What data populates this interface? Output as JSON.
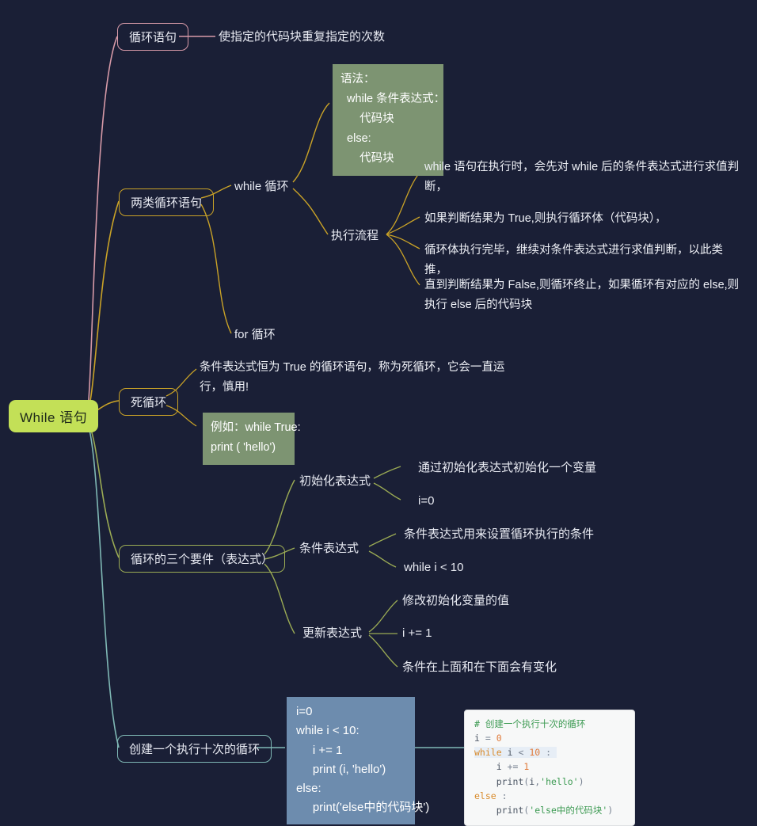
{
  "root": {
    "label": "While 语句"
  },
  "branches": {
    "loop_statement": {
      "label": "循环语句",
      "leaf": "使指定的代码块重复指定的次数"
    },
    "two_kinds": {
      "label": "两类循环语句",
      "while_loop": {
        "label": "while 循环",
        "syntax_block": "语法：\n  while 条件表达式：\n      代码块\n  else:\n      代码块",
        "flow": {
          "label": "执行流程",
          "items": [
            "while 语句在执行时，会先对 while 后的条件表达式进行求值判断，",
            "如果判断结果为 True,则执行循环体（代码块），",
            "循环体执行完毕，继续对条件表达式进行求值判断，以此类推，",
            "直到判断结果为 False,则循环终止，如果循环有对应的 else,则执行 else 后的代码块"
          ]
        }
      },
      "for_loop": {
        "label": "for 循环"
      }
    },
    "infinite_loop": {
      "label": "死循环",
      "description": "条件表达式恒为 True 的循环语句，称为死循环，它会一直运行，慎用!",
      "example_block": "例如：while True:\nprint ( 'hello')"
    },
    "three_elements": {
      "label": "循环的三个要件（表达式）",
      "items": [
        {
          "label": "初始化表达式",
          "leaves": [
            "通过初始化表达式初始化一个变量",
            "i=0"
          ]
        },
        {
          "label": "条件表达式",
          "leaves": [
            "条件表达式用来设置循环执行的条件",
            "while i < 10"
          ]
        },
        {
          "label": "更新表达式",
          "leaves": [
            "修改初始化变量的值",
            "i += 1",
            "条件在上面和在下面会有变化"
          ]
        }
      ]
    },
    "create_loop": {
      "label": "创建一个执行十次的循环",
      "code_plain": "i=0\nwhile i < 10:\n     i += 1\n     print (i, 'hello')\nelse:\n     print('else中的代码块')",
      "code_highlighted": {
        "comment": "# 创建一个执行十次的循环",
        "line_assign_var": "i",
        "line_assign_op": "=",
        "line_assign_num": "0",
        "kw_while": "while",
        "while_var": "i",
        "while_op": "<",
        "while_num": "10",
        "while_colon": ":",
        "inc_var": "i",
        "inc_op": "+=",
        "inc_num": "1",
        "print_fn": "print",
        "print_args_var": "i",
        "print_args_str": "'hello'",
        "kw_else": "else",
        "else_colon": ":",
        "print_fn2": "print",
        "print_str2": "'else中的代码块'"
      }
    }
  },
  "colors": {
    "background": "#1a1f36",
    "root_fill": "#c3e057",
    "rose": "#d79aa8",
    "gold": "#c9a227",
    "olive": "#9bab54",
    "teal": "#7fb8b5",
    "green_block": "#7d9472",
    "blue_block": "#6d8cae"
  }
}
